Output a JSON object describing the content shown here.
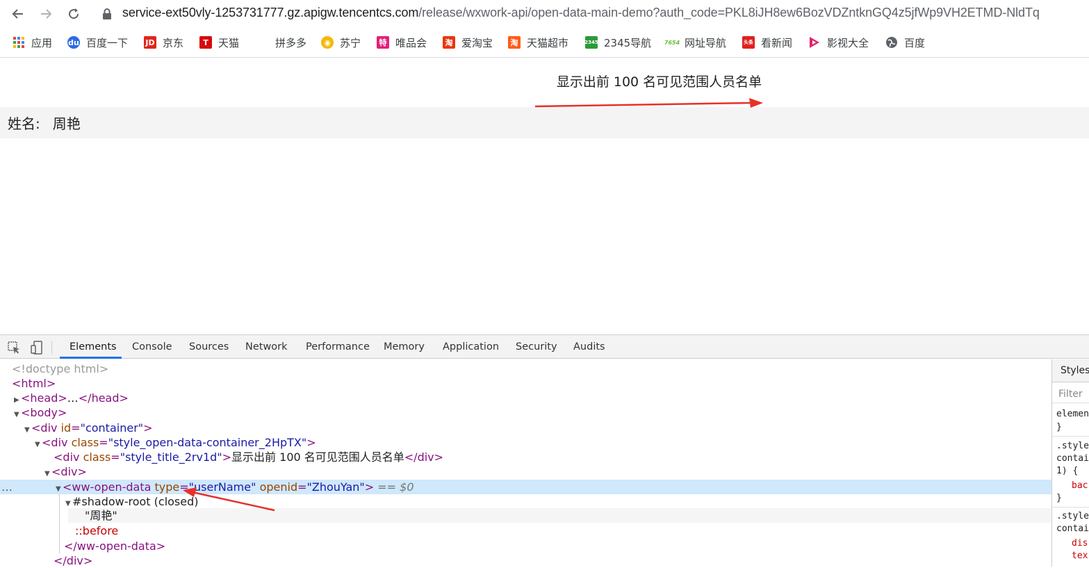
{
  "browser": {
    "url_host": "service-ext50vly-1253731777.gz.apigw.tencentcs.com",
    "url_path": "/release/wxwork-api/open-data-main-demo?auth_code=PKL8iJH8ew6BozVDZntknGQ4z5jfWp9VH2ETMD-NldTq"
  },
  "bookmarks": [
    {
      "label": "应用",
      "icon": "apps-grid-icon"
    },
    {
      "label": "百度一下",
      "icon": "baidu-paw-icon"
    },
    {
      "label": "京东",
      "icon": "jd-icon"
    },
    {
      "label": "天猫",
      "icon": "tmall-icon"
    },
    {
      "label": "拼多多",
      "icon": "pinduoduo-icon"
    },
    {
      "label": "苏宁",
      "icon": "suning-icon"
    },
    {
      "label": "唯品会",
      "icon": "vip-icon"
    },
    {
      "label": "爱淘宝",
      "icon": "taobao-icon"
    },
    {
      "label": "天猫超市",
      "icon": "tmall-market-icon"
    },
    {
      "label": "2345导航",
      "icon": "2345-icon"
    },
    {
      "label": "网址导航",
      "icon": "7654-icon"
    },
    {
      "label": "看新闻",
      "icon": "news-icon"
    },
    {
      "label": "影视大全",
      "icon": "video-play-icon"
    },
    {
      "label": "百度",
      "icon": "globe-icon"
    }
  ],
  "page": {
    "title": "显示出前 100 名可见范围人员名单",
    "name_label": "姓名:",
    "name_value": "周艳"
  },
  "devtools": {
    "tabs": [
      "Elements",
      "Console",
      "Sources",
      "Network",
      "Performance",
      "Memory",
      "Application",
      "Security",
      "Audits"
    ],
    "active_tab": "Elements",
    "dom": {
      "doctype": "<!doctype html>",
      "html_open": "<html>",
      "head_tag": "<head>",
      "head_ellipsis": "…",
      "head_close": "</head>",
      "body_tag": "<body>",
      "div_open": "<div",
      "attr_id": "id",
      "val_container": "\"container\"",
      "attr_class": "class",
      "val_open_data_container": "\"style_open-data-container_2HpTX\"",
      "val_title": "\"style_title_2rv1d\"",
      "title_text": "显示出前 100 名可见范围人员名单",
      "div_close": "</div>",
      "div_plain": "<div>",
      "ww_open": "<ww-open-data",
      "attr_type": "type",
      "val_type": "\"userName\"",
      "attr_openid": "openid",
      "val_openid": "\"ZhouYan\"",
      "selected_marker": "== $0",
      "shadow_root": "#shadow-root (closed)",
      "shadow_text": "\"周艳\"",
      "pseudo_before": "::before",
      "ww_close": "</ww-open-data>",
      "eq": "=",
      "gt": ">",
      "dots": "…"
    },
    "styles_panel": {
      "tab": "Styles",
      "filter_placeholder": "Filter",
      "lines": [
        "element",
        "}",
        ".style",
        "contai",
        "1) {",
        "bac",
        "}",
        ".style",
        "contai",
        "dis",
        "tex"
      ]
    }
  },
  "colors": {
    "accent_blue": "#1a73e8",
    "selection": "#cfe8fc",
    "annotation_red": "#e8302a",
    "tag_purple": "#881280",
    "attr_brown": "#994500",
    "value_blue": "#1a1aa6"
  }
}
